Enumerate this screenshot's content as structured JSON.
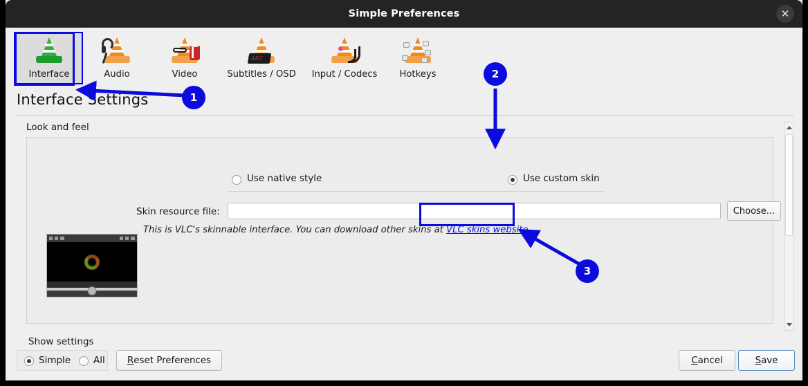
{
  "window": {
    "title": "Simple Preferences",
    "close_icon": "close-icon",
    "close_glyph": "✕"
  },
  "toolbar": {
    "items": [
      {
        "label": "Interface",
        "icon": "vlc-cone-interface-icon",
        "selected": true
      },
      {
        "label": "Audio",
        "icon": "vlc-cone-headset-icon",
        "selected": false
      },
      {
        "label": "Video",
        "icon": "vlc-cone-popcorn-icon",
        "selected": false
      },
      {
        "label": "Subtitles / OSD",
        "icon": "vlc-cone-osd-icon",
        "selected": false
      },
      {
        "label": "Input / Codecs",
        "icon": "vlc-cone-cable-icon",
        "selected": false
      },
      {
        "label": "Hotkeys",
        "icon": "vlc-cone-keys-icon",
        "selected": false
      }
    ]
  },
  "page": {
    "title": "Interface Settings"
  },
  "look_and_feel": {
    "group_label": "Look and feel",
    "native_style": {
      "label": "Use native style",
      "checked": false
    },
    "custom_skin": {
      "label": "Use custom skin",
      "checked": true
    },
    "skin_resource": {
      "label": "Skin resource file:",
      "value": "",
      "placeholder": ""
    },
    "choose_button": "Choose...",
    "hint": {
      "prefix": "This is VLC's skinnable interface. You can download other skins at ",
      "link": "VLC skins website",
      "suffix": "."
    },
    "preview": {
      "name": "skin-preview-thumbnail"
    }
  },
  "footer": {
    "show_settings_label": "Show settings",
    "simple": {
      "label": "Simple",
      "checked": true
    },
    "all": {
      "label": "All",
      "checked": false
    },
    "reset_button": {
      "mnemonic": "R",
      "rest": "eset Preferences"
    },
    "cancel_button": {
      "mnemonic": "C",
      "rest": "ancel"
    },
    "save_button": {
      "mnemonic": "S",
      "rest": "ave"
    }
  },
  "scrollbar": {
    "up_icon": "scroll-up-arrow-icon",
    "down_icon": "scroll-down-arrow-icon"
  },
  "annotations": {
    "badges": [
      {
        "number": "1",
        "points_to": "interface-tab"
      },
      {
        "number": "2",
        "points_to": "use-custom-skin-radio"
      },
      {
        "number": "3",
        "points_to": "vlc-skins-website-link"
      }
    ],
    "accent_color": "#0b0bdd"
  }
}
